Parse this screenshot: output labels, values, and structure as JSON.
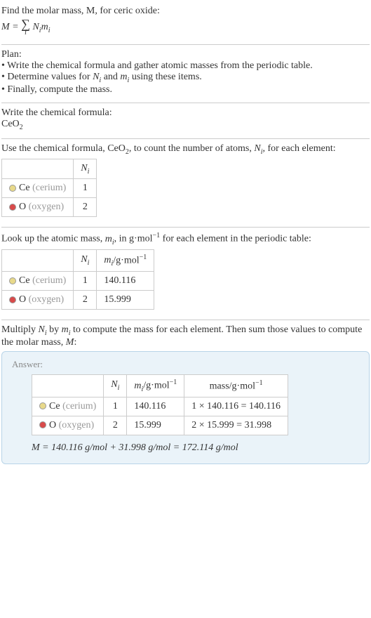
{
  "intro": {
    "line1": "Find the molar mass, M, for ceric oxide:",
    "formula_lhs": "M = ",
    "formula_rhs": "N_i m_i"
  },
  "plan": {
    "heading": "Plan:",
    "bullet1": "• Write the chemical formula and gather atomic masses from the periodic table.",
    "bullet2_pre": "• Determine values for ",
    "bullet2_mid": " and ",
    "bullet2_post": " using these items.",
    "bullet3": "• Finally, compute the mass."
  },
  "step_formula": {
    "heading": "Write the chemical formula:",
    "formula": "CeO",
    "formula_sub": "2"
  },
  "step_count": {
    "text_pre": "Use the chemical formula, CeO",
    "text_sub": "2",
    "text_mid": ", to count the number of atoms, ",
    "text_post": ", for each element:",
    "header_ni": "N",
    "rows": [
      {
        "color": "#e8d98a",
        "sym": "Ce",
        "name": "(cerium)",
        "ni": "1"
      },
      {
        "color": "#d94a4a",
        "sym": "O",
        "name": "(oxygen)",
        "ni": "2"
      }
    ]
  },
  "step_mass": {
    "text_pre": "Look up the atomic mass, ",
    "text_mid": ", in g·mol",
    "text_sup": "−1",
    "text_post": " for each element in the periodic table:",
    "header_ni": "N",
    "header_mi_pre": "m",
    "header_mi_unit": "/g·mol",
    "header_mi_sup": "−1",
    "rows": [
      {
        "color": "#e8d98a",
        "sym": "Ce",
        "name": "(cerium)",
        "ni": "1",
        "mi": "140.116"
      },
      {
        "color": "#d94a4a",
        "sym": "O",
        "name": "(oxygen)",
        "ni": "2",
        "mi": "15.999"
      }
    ]
  },
  "step_compute": {
    "text_pre": "Multiply ",
    "text_mid1": " by ",
    "text_mid2": " to compute the mass for each element. Then sum those values to compute the molar mass, ",
    "text_post": ":"
  },
  "answer": {
    "label": "Answer:",
    "header_ni": "N",
    "header_mi_pre": "m",
    "header_mi_unit": "/g·mol",
    "header_mi_sup": "−1",
    "header_mass": "mass/g·mol",
    "header_mass_sup": "−1",
    "rows": [
      {
        "color": "#e8d98a",
        "sym": "Ce",
        "name": "(cerium)",
        "ni": "1",
        "mi": "140.116",
        "mass": "1 × 140.116 = 140.116"
      },
      {
        "color": "#d94a4a",
        "sym": "O",
        "name": "(oxygen)",
        "ni": "2",
        "mi": "15.999",
        "mass": "2 × 15.999 = 31.998"
      }
    ],
    "final": "M = 140.116 g/mol + 31.998 g/mol = 172.114 g/mol"
  }
}
